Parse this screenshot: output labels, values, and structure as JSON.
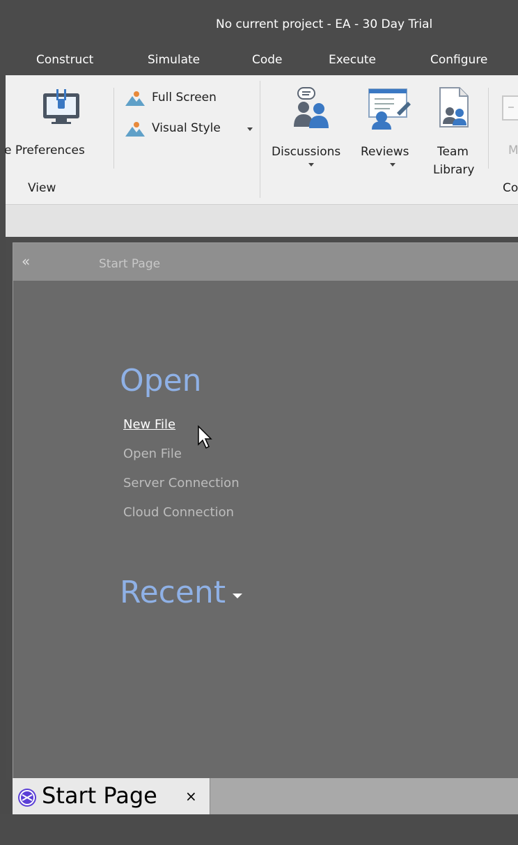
{
  "window": {
    "title": "No current project - EA - 30 Day Trial"
  },
  "menu": {
    "items": [
      {
        "label": "Construct"
      },
      {
        "label": "Simulate"
      },
      {
        "label": "Code"
      },
      {
        "label": "Execute"
      },
      {
        "label": "Configure"
      }
    ]
  },
  "ribbon": {
    "preferences_label": "e Preferences",
    "full_screen_label": "Full Screen",
    "visual_style_label": "Visual Style",
    "discussions_label": "Discussions",
    "reviews_label": "Reviews",
    "team_label": "Team",
    "library_label": "Library",
    "partial_m": "M",
    "view_group_label": "View",
    "partial_group_label": "Co"
  },
  "panel": {
    "title": "Start Page",
    "collapse_glyph": "«"
  },
  "start": {
    "open_heading": "Open",
    "links": [
      {
        "label": "New File"
      },
      {
        "label": "Open File"
      },
      {
        "label": "Server Connection"
      },
      {
        "label": "Cloud Connection"
      }
    ],
    "recent_heading": "Recent"
  },
  "tab": {
    "label": "Start Page",
    "close": "×"
  },
  "colors": {
    "heading_blue": "#8fb1e6",
    "panel_bg": "#6a6a6a",
    "chrome_dark": "#4b4b4b"
  }
}
